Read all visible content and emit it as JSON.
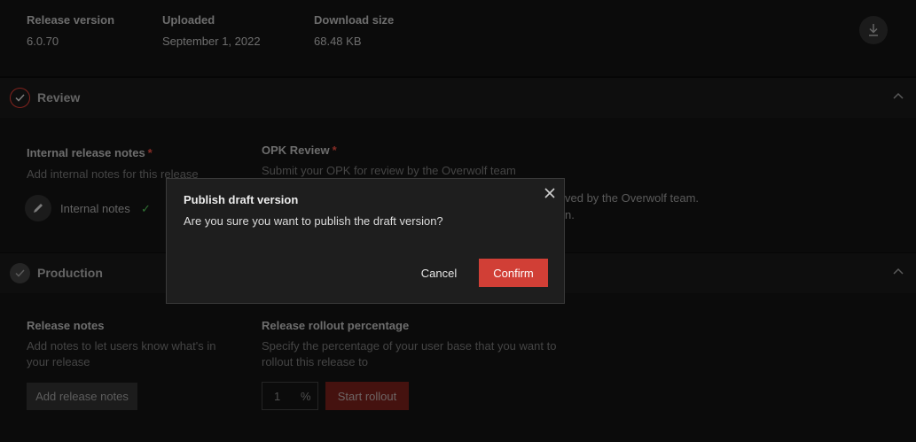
{
  "release_info": {
    "version_label": "Release version",
    "version_value": "6.0.70",
    "uploaded_label": "Uploaded",
    "uploaded_value": "September 1, 2022",
    "size_label": "Download size",
    "size_value": "68.48 KB",
    "download_icon": "download-icon"
  },
  "review": {
    "title": "Review",
    "internal_notes_title": "Internal release notes",
    "internal_notes_required": "*",
    "internal_notes_sub": "Add internal notes for this release",
    "internal_notes_item": "Internal notes",
    "internal_notes_check": "✓",
    "opk_title": "OPK Review",
    "opk_required": "*",
    "opk_sub": "Submit your OPK for review by the Overwolf team",
    "opk_partial_1": "ved by the Overwolf team.",
    "opk_partial_2": "n."
  },
  "production": {
    "title": "Production",
    "release_notes_title": "Release notes",
    "release_notes_sub_1": "Add notes to let users know what's in",
    "release_notes_sub_2": "your release",
    "add_notes_button": "Add release notes",
    "rollout_title": "Release rollout percentage",
    "rollout_sub_1": "Specify the percentage of your user base that you want to",
    "rollout_sub_2": "rollout this release to",
    "rollout_value": "1",
    "rollout_unit": "%",
    "start_rollout_button": "Start rollout"
  },
  "modal": {
    "title": "Publish draft version",
    "message": "Are you sure you want to publish the draft version?",
    "cancel": "Cancel",
    "confirm": "Confirm"
  },
  "colors": {
    "accent": "#d13f36",
    "background": "#0a0a0a"
  }
}
